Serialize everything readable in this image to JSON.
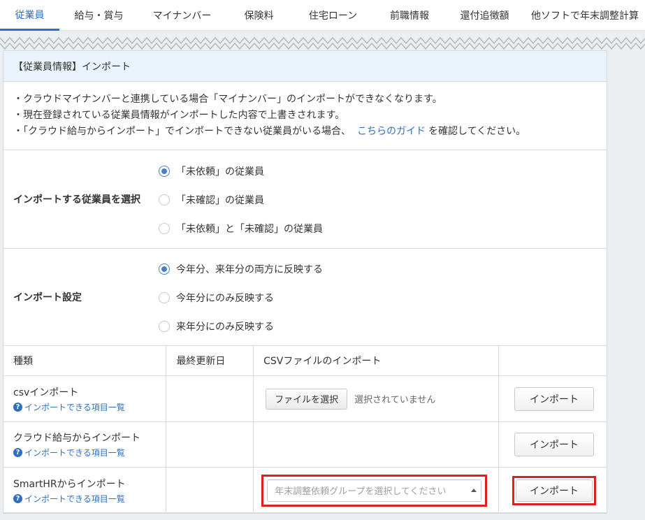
{
  "tabs": [
    "従業員",
    "給与・賞与",
    "マイナンバー",
    "保険料",
    "住宅ローン",
    "前職情報",
    "還付追徴額",
    "他ソフトで年末調整計算"
  ],
  "panel_title": "【従業員情報】インポート",
  "notes": {
    "line1": "・クラウドマイナンバーと連携している場合「マイナンバー」のインポートができなくなります。",
    "line2": "・現在登録されている従業員情報がインポートした内容で上書きされます。",
    "line3_prefix": "・「クラウド給与からインポート」でインポートできない従業員がいる場合、",
    "line3_link": "こちらのガイド",
    "line3_suffix": "を確認してください。"
  },
  "employee_select": {
    "label": "インポートする従業員を選択",
    "options": [
      "「未依頼」の従業員",
      "「未確認」の従業員",
      "「未依頼」と「未確認」の従業員"
    ],
    "selected": 0
  },
  "import_setting": {
    "label": "インポート設定",
    "options": [
      "今年分、来年分の両方に反映する",
      "今年分にのみ反映する",
      "来年分にのみ反映する"
    ],
    "selected": 0
  },
  "table": {
    "headers": [
      "種類",
      "最終更新日",
      "CSVファイルのインポート",
      ""
    ],
    "help_label": "インポートできる項目一覧",
    "import_button": "インポート",
    "rows": [
      {
        "title": "csvインポート",
        "last_updated": "",
        "file_button": "ファイルを選択",
        "file_status": "選択されていません"
      },
      {
        "title": "クラウド給与からインポート",
        "last_updated": ""
      },
      {
        "title": "SmartHRからインポート",
        "last_updated": "",
        "select_placeholder": "年末調整依頼グループを選択してください"
      }
    ]
  },
  "colors": {
    "accent": "#2f6fbf",
    "highlight": "#e0201f",
    "header_bg": "#eaf3fb"
  }
}
